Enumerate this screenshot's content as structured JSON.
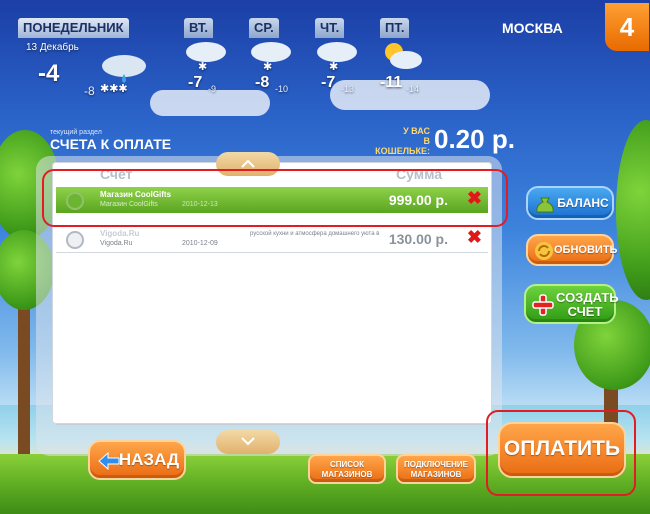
{
  "weather": {
    "today": {
      "day": "ПОНЕДЕЛЬНИК",
      "date": "13 Декабрь",
      "temp": "-4",
      "temp_low": "-8",
      "icon": "rain-snow-icon"
    },
    "days": [
      {
        "day": "ВТ.",
        "temp": "-7",
        "temp_low": "-9",
        "icon": "snow-cloud-icon"
      },
      {
        "day": "СР.",
        "temp": "-8",
        "temp_low": "-10",
        "icon": "snow-cloud-icon"
      },
      {
        "day": "ЧТ.",
        "temp": "-7",
        "temp_low": "-13",
        "icon": "snow-cloud-icon"
      },
      {
        "day": "ПТ.",
        "temp": "-11",
        "temp_low": "-14",
        "icon": "sun-cloud-icon"
      }
    ],
    "city": "МОСКВА"
  },
  "step_badge": "4",
  "section": {
    "small_label": "текущий раздел",
    "title": "СЧЕТА К ОПЛАТЕ"
  },
  "wallet": {
    "label_line1": "У ВАС",
    "label_line2": "В КОШЕЛЬКЕ:",
    "amount": "0.20 р."
  },
  "table": {
    "columns": [
      "Счет",
      "Сумма"
    ],
    "rows": [
      {
        "title": "Магазин CoolGifts",
        "sub": "Магазин CoolGifts",
        "date": "2010-12-13",
        "desc": "",
        "amount": "999.00 р.",
        "selected": true
      },
      {
        "title": "Vigoda.Ru",
        "sub": "Vigoda.Ru",
        "date": "2010-12-09",
        "desc": "русской кухни и атмосфера домашнего уюта в",
        "amount": "130.00 р.",
        "selected": false
      }
    ]
  },
  "buttons": {
    "balance": "БАЛАНС",
    "refresh": "ОБНОВИТЬ",
    "create_line1": "СОЗДАТЬ",
    "create_line2": "СЧЕТ",
    "back": "НАЗАД",
    "shops_line1": "СПИСОК",
    "shops_line2": "МАГАЗИНОВ",
    "connect_line1": "ПОДКЛЮЧЕНИЕ",
    "connect_line2": "МАГАЗИНОВ",
    "pay": "ОПЛАТИТЬ"
  },
  "colors": {
    "highlight": "#e31b23",
    "selected_row": "#6bbf2c",
    "accent_orange": "#ea6b12",
    "accent_blue": "#1a6fd0",
    "delete": "#e01818"
  }
}
